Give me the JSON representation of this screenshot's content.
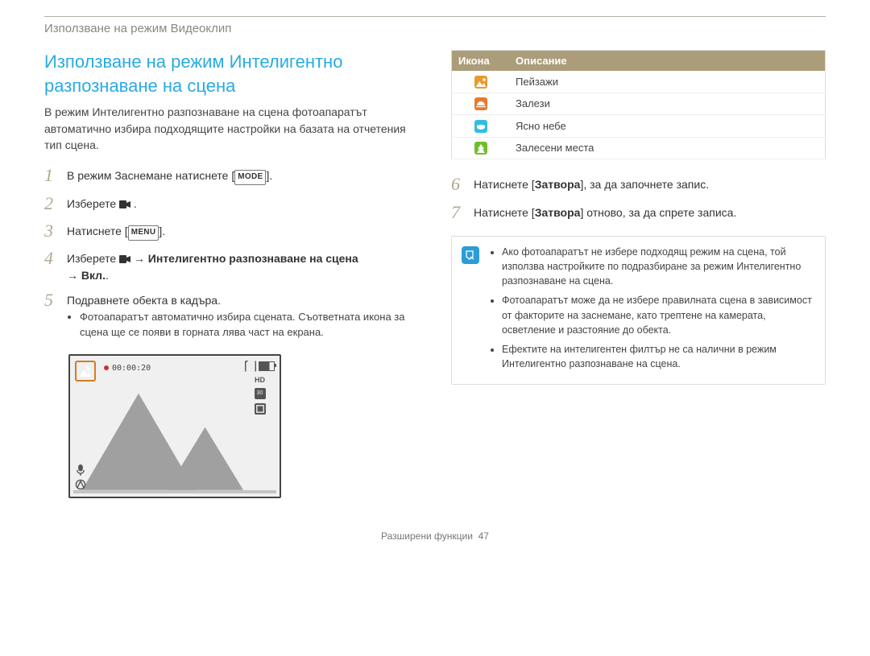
{
  "breadcrumb": "Използване на режим Видеоклип",
  "left": {
    "title": "Използване на режим Интелигентно разпознаване на сцена",
    "intro": "В режим Интелигентно разпознаване на сцена фотоапаратът автоматично избира подходящите настройки на базата на отчетения тип сцена.",
    "steps": {
      "1": {
        "num": "1",
        "pre": "В режим Заснемане натиснете [",
        "box": "MODE",
        "post": "]."
      },
      "2": {
        "num": "2",
        "text": "Изберете ",
        "post": "."
      },
      "3": {
        "num": "3",
        "pre": "Натиснете [",
        "box": "MENU",
        "post": "]."
      },
      "4": {
        "num": "4",
        "pre": "Изберете ",
        "arrow1": " → ",
        "bold1": "Интелигентно разпознаване на сцена",
        "arrow2": " → ",
        "bold2": "Вкл.",
        "post": "."
      },
      "5": {
        "num": "5",
        "text": "Подравнете обекта в кадъра."
      },
      "5_sub": "Фотоапаратът автоматично избира сцената. Съответната икона за сцена ще се появи в горната лява част на екрана."
    },
    "lcd": {
      "rec_time": "00:00:20",
      "hd_label": "HD",
      "fps_label": "30"
    }
  },
  "right": {
    "table": {
      "headers": {
        "icon": "Икона",
        "desc": "Описание"
      },
      "rows": [
        {
          "desc": "Пейзажи"
        },
        {
          "desc": "Залези"
        },
        {
          "desc": "Ясно небе"
        },
        {
          "desc": "Залесени места"
        }
      ]
    },
    "steps": {
      "6": {
        "num": "6",
        "pre": "Натиснете [",
        "bold": "Затвора",
        "post": "], за да започнете запис."
      },
      "7": {
        "num": "7",
        "pre": "Натиснете [",
        "bold": "Затвора",
        "post": "] отново, за да спрете записа."
      }
    },
    "info": [
      "Ако фотоапаратът не избере подходящ режим на сцена, той използва настройките по подразбиране за режим Интелигентно разпознаване на сцена.",
      "Фотоапаратът може да не избере правилната сцена в зависимост от факторите на заснемане, като трептене на камерата, осветление и разстояние до обекта.",
      "Ефектите на интелигентен филтър не са налични в режим Интелигентно разпознаване на сцена."
    ]
  },
  "footer": {
    "label": "Разширени функции",
    "page": "47"
  }
}
